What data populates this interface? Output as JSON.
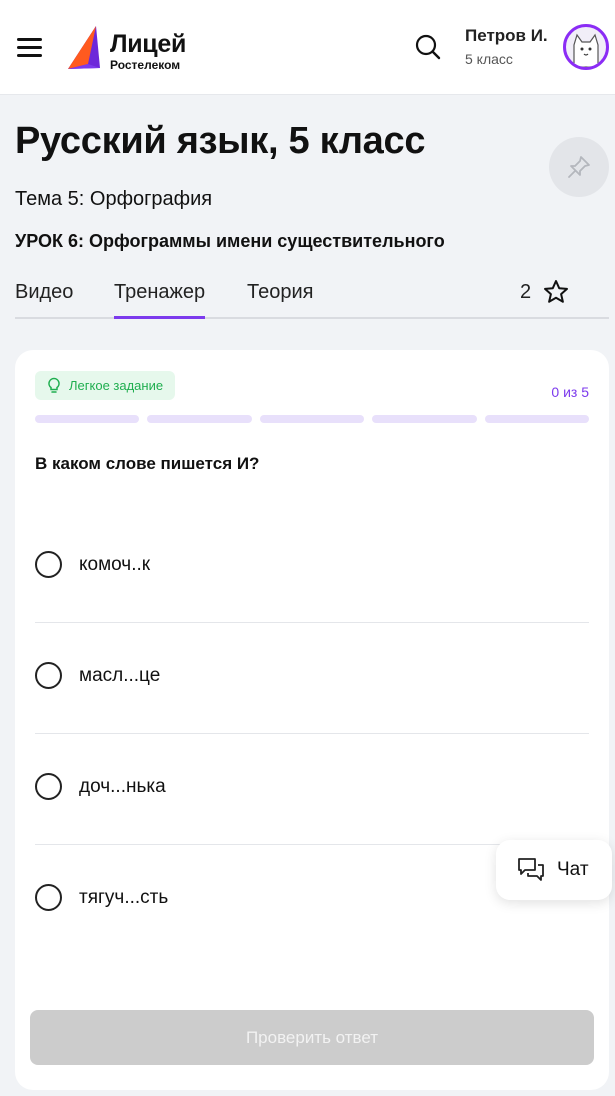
{
  "header": {
    "logo_title": "Лицей",
    "logo_subtitle": "Ростелеком",
    "user_name": "Петров И.",
    "user_grade": "5 класс"
  },
  "lesson": {
    "course_title": "Русский язык, 5 класс",
    "topic": "Тема 5: Орфография",
    "lesson_title": "УРОК 6: Орфограммы имени существительного"
  },
  "tabs": [
    {
      "label": "Видео",
      "active": false
    },
    {
      "label": "Тренажер",
      "active": true
    },
    {
      "label": "Теория",
      "active": false
    }
  ],
  "favorites": {
    "count": "2"
  },
  "exercise": {
    "difficulty": "Легкое задание",
    "progress_text": "0 из 5",
    "progress_done": 0,
    "progress_total": 5,
    "question": "В каком слове пишется И?",
    "options": [
      {
        "label": "комоч..к"
      },
      {
        "label": "масл...це"
      },
      {
        "label": "доч...нька"
      },
      {
        "label": "тягуч...сть"
      }
    ],
    "check_button": "Проверить ответ"
  },
  "chat": {
    "label": "Чат"
  },
  "colors": {
    "accent": "#7c3aed",
    "avatar_border": "#8b2cf5",
    "difficulty_text": "#1fae4f",
    "difficulty_bg": "#e6f8ec",
    "segment_empty": "#e8e0fb",
    "disabled_button": "#cccccc"
  },
  "icons": {
    "menu": "hamburger-icon",
    "search": "search-icon",
    "pin": "pin-icon",
    "favorite": "star-icon",
    "difficulty": "lightbulb-icon",
    "chat": "chat-bubbles-icon"
  }
}
